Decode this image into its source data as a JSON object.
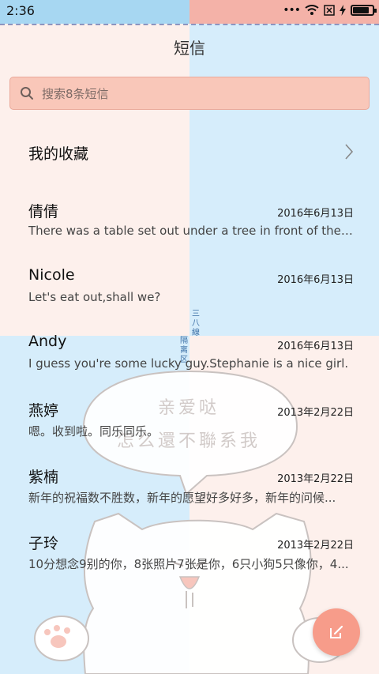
{
  "status_bar": {
    "time": "2:36",
    "more": "•••"
  },
  "header": {
    "title": "短信"
  },
  "search": {
    "placeholder": "搜索8条短信"
  },
  "favorites": {
    "label": "我的收藏"
  },
  "divider": {
    "top_text": "三八線",
    "bottom_text": "隔离区"
  },
  "messages": [
    {
      "name": "倩倩",
      "date": "2016年6月13日",
      "preview": "There was a table set out under a tree in front of the h..."
    },
    {
      "name": "Nicole",
      "date": "2016年6月13日",
      "preview": "Let's eat out,shall we?"
    },
    {
      "name": "Andy",
      "date": "2016年6月13日",
      "preview": "I guess you're some lucky guy.Stephanie is a nice girl."
    },
    {
      "name": "燕婷",
      "date": "2013年2月22日",
      "preview": "嗯。收到啦。同乐同乐。"
    },
    {
      "name": "紫楠",
      "date": "2013年2月22日",
      "preview": "新年的祝福数不胜数，新年的愿望好多好多，新年的问候..."
    },
    {
      "name": "子玲",
      "date": "2013年2月22日",
      "preview": "10分想念9别的你，8张照片7张是你，6只小狗5只像你，4..."
    }
  ],
  "wallpaper": {
    "bubble_line1": "亲爱哒",
    "bubble_line2": "怎么還不聯系我"
  },
  "colors": {
    "accent": "#f79c8a",
    "search_bg": "#f9c7b9",
    "blue": "#d6edfb",
    "pink": "#fdf0ec"
  },
  "battery_level": 0.85,
  "icons": [
    "search-icon",
    "chevron-right-icon",
    "compose-icon",
    "wifi-icon",
    "battery-icon"
  ]
}
